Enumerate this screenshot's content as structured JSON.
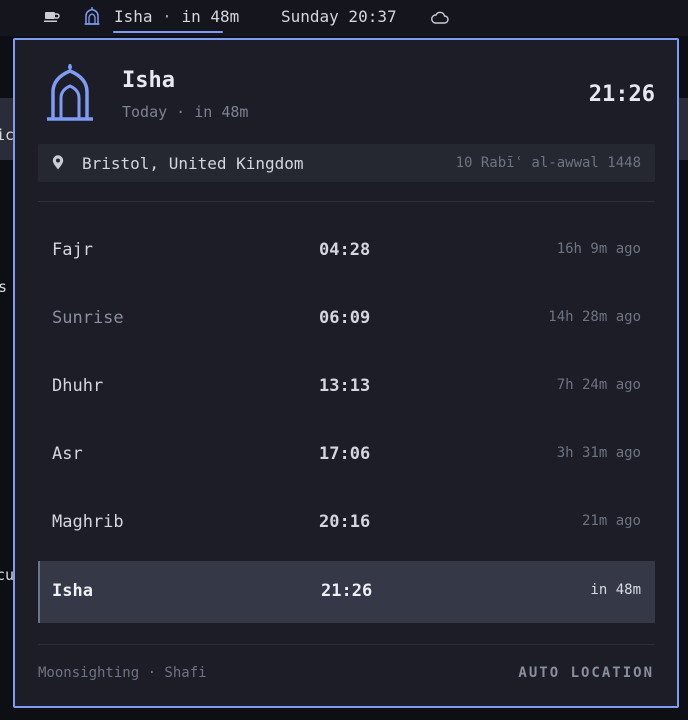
{
  "topbar": {
    "current_prayer": "Isha",
    "separator": "·",
    "countdown": "in 48m",
    "datetime": "Sunday 20:37"
  },
  "background": {
    "fragment_1": "ic",
    "fragment_2": "s",
    "fragment_3": "cu"
  },
  "header": {
    "prayer": "Isha",
    "subtitle": "Today · in 48m",
    "time": "21:26"
  },
  "location": {
    "city": "Bristol, United Kingdom",
    "hijri_date": "10 Rabīʿ al-awwal 1448"
  },
  "prayers": [
    {
      "name": "Fajr",
      "time": "04:28",
      "relative": "16h 9m ago"
    },
    {
      "name": "Sunrise",
      "time": "06:09",
      "relative": "14h 28m ago"
    },
    {
      "name": "Dhuhr",
      "time": "13:13",
      "relative": "7h 24m ago"
    },
    {
      "name": "Asr",
      "time": "17:06",
      "relative": "3h 31m ago"
    },
    {
      "name": "Maghrib",
      "time": "20:16",
      "relative": "21m ago"
    },
    {
      "name": "Isha",
      "time": "21:26",
      "relative": "in 48m"
    }
  ],
  "footer": {
    "method": "Moonsighting · Shafi",
    "auto_location": "AUTO LOCATION"
  },
  "colors": {
    "accent": "#7f9cf5",
    "panel_bg": "#1c1d26",
    "active_row": "#353846"
  }
}
